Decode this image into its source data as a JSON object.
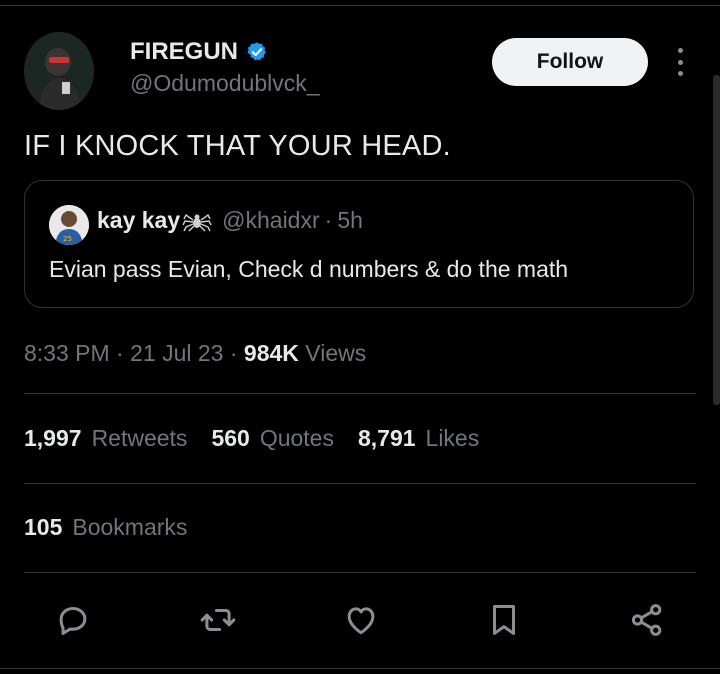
{
  "tweet": {
    "author_name": "FIREGUN",
    "author_handle": "@Odumodublvck_",
    "follow_label": "Follow",
    "text": "IF I KNOCK THAT YOUR HEAD.",
    "icons": {
      "verified": "verified-badge-icon",
      "more": "more-options-icon"
    },
    "accent_color": "#1d9bf0"
  },
  "quote": {
    "name": "kay kay",
    "emoji_icon": "spider-icon",
    "handle": "@khaidxr",
    "separator": "·",
    "time": "5h",
    "text": "Evian pass Evian, Check d numbers & do the math"
  },
  "meta": {
    "time": "8:33 PM",
    "dot": "·",
    "date": "21 Jul 23",
    "views_count": "984K",
    "views_label": "Views"
  },
  "stats": {
    "retweets_count": "1,997",
    "retweets_label": "Retweets",
    "quotes_count": "560",
    "quotes_label": "Quotes",
    "likes_count": "8,791",
    "likes_label": "Likes",
    "bookmarks_count": "105",
    "bookmarks_label": "Bookmarks"
  },
  "actions": [
    "reply-icon",
    "retweet-icon",
    "like-icon",
    "bookmark-icon",
    "share-icon"
  ]
}
